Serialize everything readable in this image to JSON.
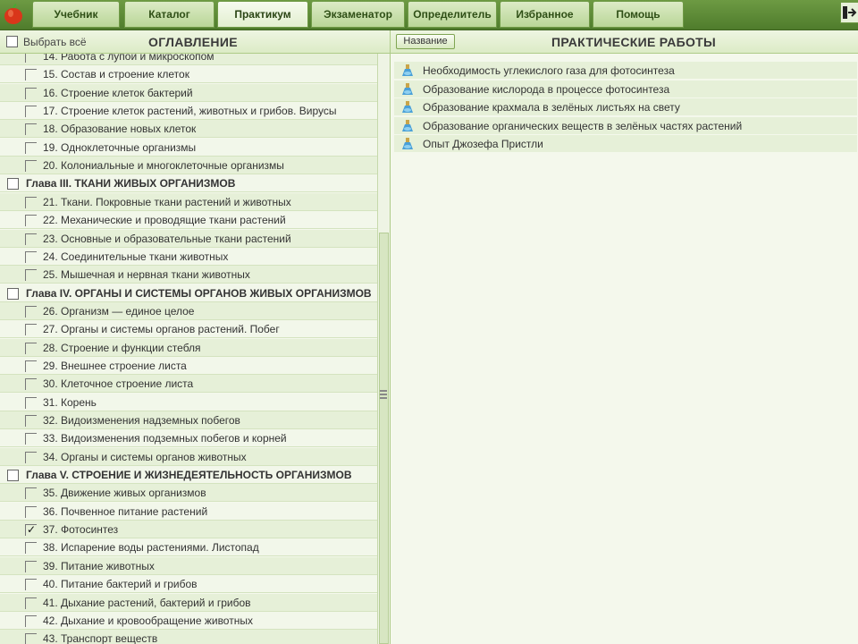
{
  "tabs": [
    {
      "label": "Учебник",
      "active": false
    },
    {
      "label": "Каталог",
      "active": false
    },
    {
      "label": "Практикум",
      "active": true
    },
    {
      "label": "Экзаменатор",
      "active": false
    },
    {
      "label": "Определитель",
      "active": false
    },
    {
      "label": "Избранное",
      "active": false
    },
    {
      "label": "Помощь",
      "active": false
    }
  ],
  "left_panel": {
    "select_all_label": "Выбрать всё",
    "title": "ОГЛАВЛЕНИЕ",
    "items": [
      {
        "type": "lesson",
        "label": "14. Работа с лупой и микроскопом",
        "checked": false
      },
      {
        "type": "lesson",
        "label": "15. Состав и строение клеток",
        "checked": false
      },
      {
        "type": "lesson",
        "label": "16. Строение клеток бактерий",
        "checked": false
      },
      {
        "type": "lesson",
        "label": "17. Строение клеток растений, животных и грибов. Вирусы",
        "checked": false
      },
      {
        "type": "lesson",
        "label": "18. Образование новых клеток",
        "checked": false
      },
      {
        "type": "lesson",
        "label": "19. Одноклеточные организмы",
        "checked": false
      },
      {
        "type": "lesson",
        "label": "20. Колониальные и многоклеточные организмы",
        "checked": false
      },
      {
        "type": "chapter",
        "label": "Глава III. ТКАНИ ЖИВЫХ ОРГАНИЗМОВ",
        "checked": false
      },
      {
        "type": "lesson",
        "label": "21. Ткани. Покровные ткани растений и животных",
        "checked": false
      },
      {
        "type": "lesson",
        "label": "22. Механические и проводящие ткани растений",
        "checked": false
      },
      {
        "type": "lesson",
        "label": "23. Основные и образовательные ткани растений",
        "checked": false
      },
      {
        "type": "lesson",
        "label": "24. Соединительные ткани животных",
        "checked": false
      },
      {
        "type": "lesson",
        "label": "25. Мышечная и нервная ткани животных",
        "checked": false
      },
      {
        "type": "chapter",
        "label": "Глава IV. ОРГАНЫ И СИСТЕМЫ ОРГАНОВ ЖИВЫХ ОРГАНИЗМОВ",
        "checked": false
      },
      {
        "type": "lesson",
        "label": "26. Организм — единое целое",
        "checked": false
      },
      {
        "type": "lesson",
        "label": "27. Органы и системы органов растений. Побег",
        "checked": false
      },
      {
        "type": "lesson",
        "label": "28. Строение и функции стебля",
        "checked": false
      },
      {
        "type": "lesson",
        "label": "29. Внешнее строение листа",
        "checked": false
      },
      {
        "type": "lesson",
        "label": "30. Клеточное строение листа",
        "checked": false
      },
      {
        "type": "lesson",
        "label": "31. Корень",
        "checked": false
      },
      {
        "type": "lesson",
        "label": "32. Видоизменения надземных побегов",
        "checked": false
      },
      {
        "type": "lesson",
        "label": "33. Видоизменения подземных побегов и корней",
        "checked": false
      },
      {
        "type": "lesson",
        "label": "34. Органы и системы органов животных",
        "checked": false
      },
      {
        "type": "chapter",
        "label": "Глава V. СТРОЕНИЕ И ЖИЗНЕДЕЯТЕЛЬНОСТЬ ОРГАНИЗМОВ",
        "checked": false
      },
      {
        "type": "lesson",
        "label": "35. Движение живых организмов",
        "checked": false
      },
      {
        "type": "lesson",
        "label": "36. Почвенное питание растений",
        "checked": false
      },
      {
        "type": "lesson",
        "label": "37. Фотосинтез",
        "checked": true
      },
      {
        "type": "lesson",
        "label": "38. Испарение воды растениями. Листопад",
        "checked": false
      },
      {
        "type": "lesson",
        "label": "39. Питание животных",
        "checked": false
      },
      {
        "type": "lesson",
        "label": "40. Питание бактерий и грибов",
        "checked": false
      },
      {
        "type": "lesson",
        "label": "41. Дыхание растений, бактерий и грибов",
        "checked": false
      },
      {
        "type": "lesson",
        "label": "42. Дыхание и кровообращение животных",
        "checked": false
      },
      {
        "type": "lesson",
        "label": "43. Транспорт веществ",
        "checked": false
      }
    ]
  },
  "right_panel": {
    "sort_button_label": "Название",
    "title": "ПРАКТИЧЕСКИЕ РАБОТЫ",
    "items": [
      "Необходимость углекислого газа для фотосинтеза",
      "Образование кислорода в процессе фотосинтеза",
      "Образование крахмала в зелёных листьях на свету",
      "Образование органических веществ в зелёных частях растений",
      "Опыт Джозефа Пристли"
    ]
  },
  "icons": {
    "logo": "apple-icon",
    "exit": "exit-icon",
    "work_item": "flask-icon"
  },
  "colors": {
    "topbar": "#5a8736",
    "row_alt": "#e6f0d8",
    "row_plain": "#f2f7ea"
  }
}
